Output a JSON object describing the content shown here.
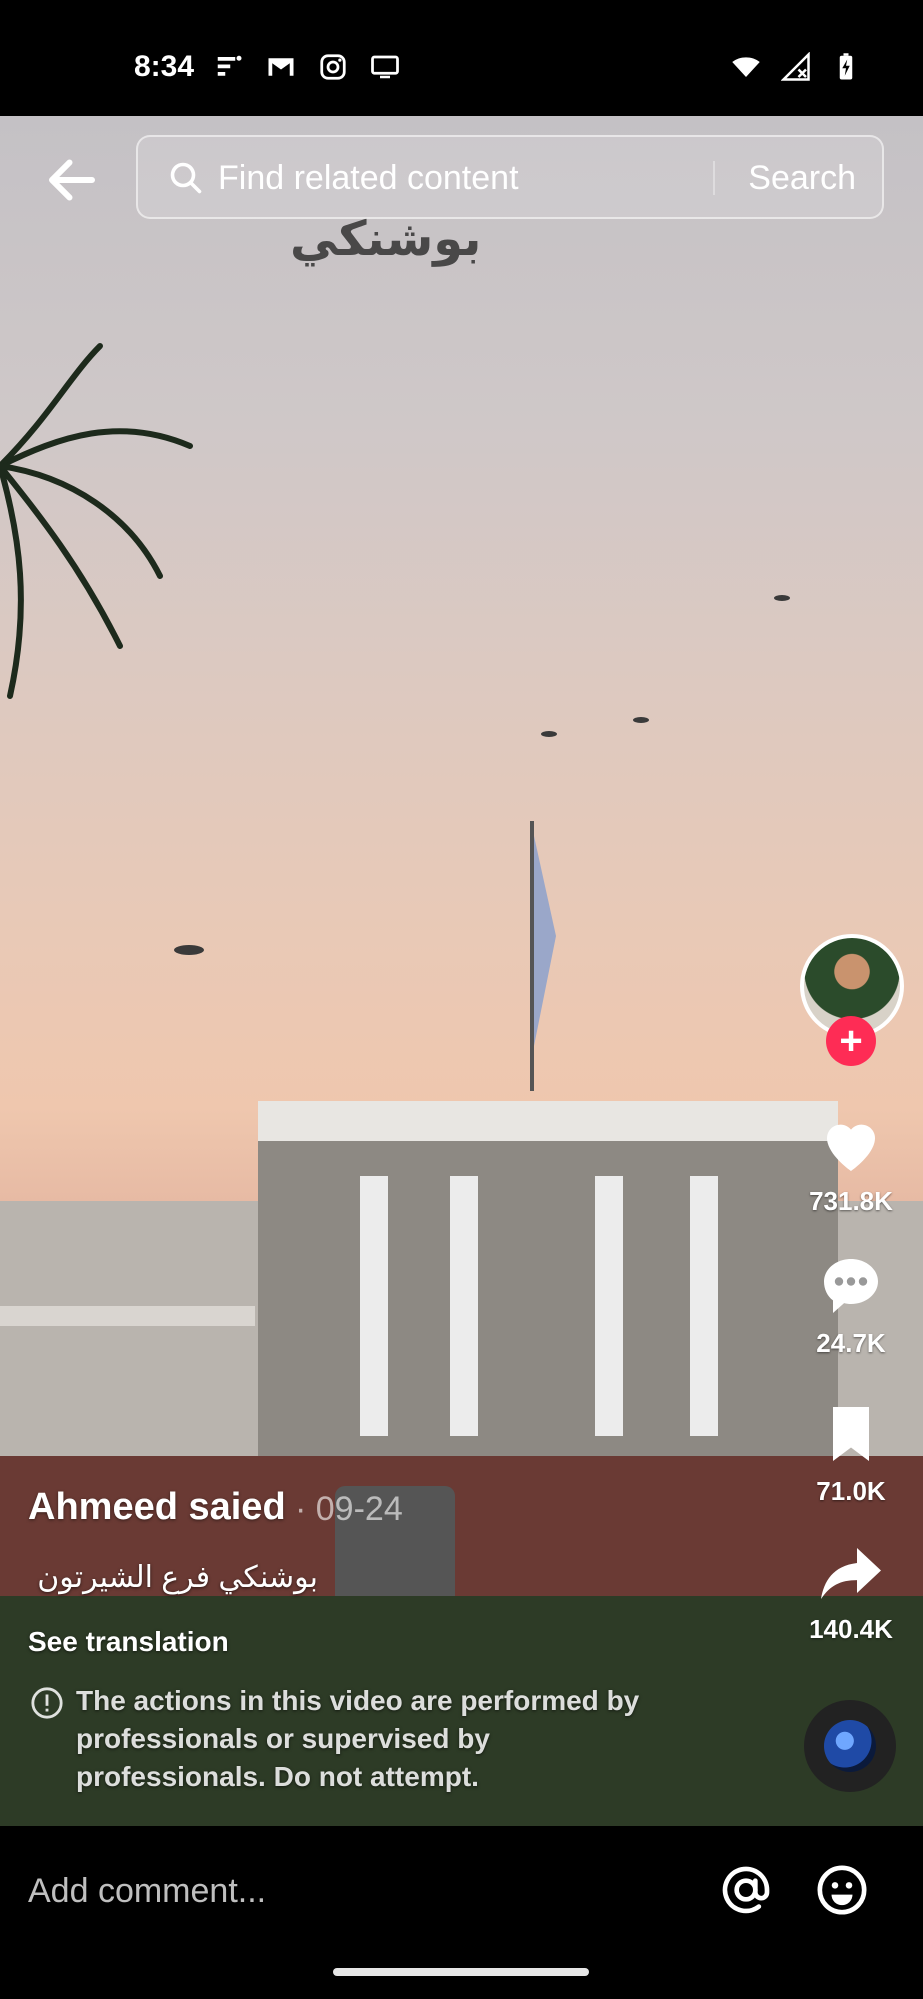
{
  "status_bar": {
    "time": "8:34",
    "left_icons": [
      "feed-icon",
      "gmail-icon",
      "instagram-icon",
      "cast-icon"
    ],
    "right_icons": [
      "wifi-icon",
      "signal-icon",
      "battery-charging-icon"
    ]
  },
  "header": {
    "back_icon": "arrow-left-icon",
    "search_placeholder": "Find related content",
    "search_button": "Search"
  },
  "video": {
    "overlay_title": "بوشنكي"
  },
  "actions": {
    "likes": "731.8K",
    "comments": "24.7K",
    "saves": "71.0K",
    "shares": "140.4K",
    "follow_label": "+"
  },
  "post": {
    "author": "Ahmeed saied",
    "date": "· 09-24",
    "caption": "بوشنكي فرع الشيرتون",
    "see_translation": "See translation",
    "warning": "The actions in this video are performed by professionals or supervised by professionals. Do not attempt."
  },
  "comment_bar": {
    "placeholder": "Add comment...",
    "mention_icon": "at-icon",
    "emoji_icon": "emoji-icon"
  },
  "colors": {
    "accent": "#fe2c55",
    "background": "#000000"
  }
}
